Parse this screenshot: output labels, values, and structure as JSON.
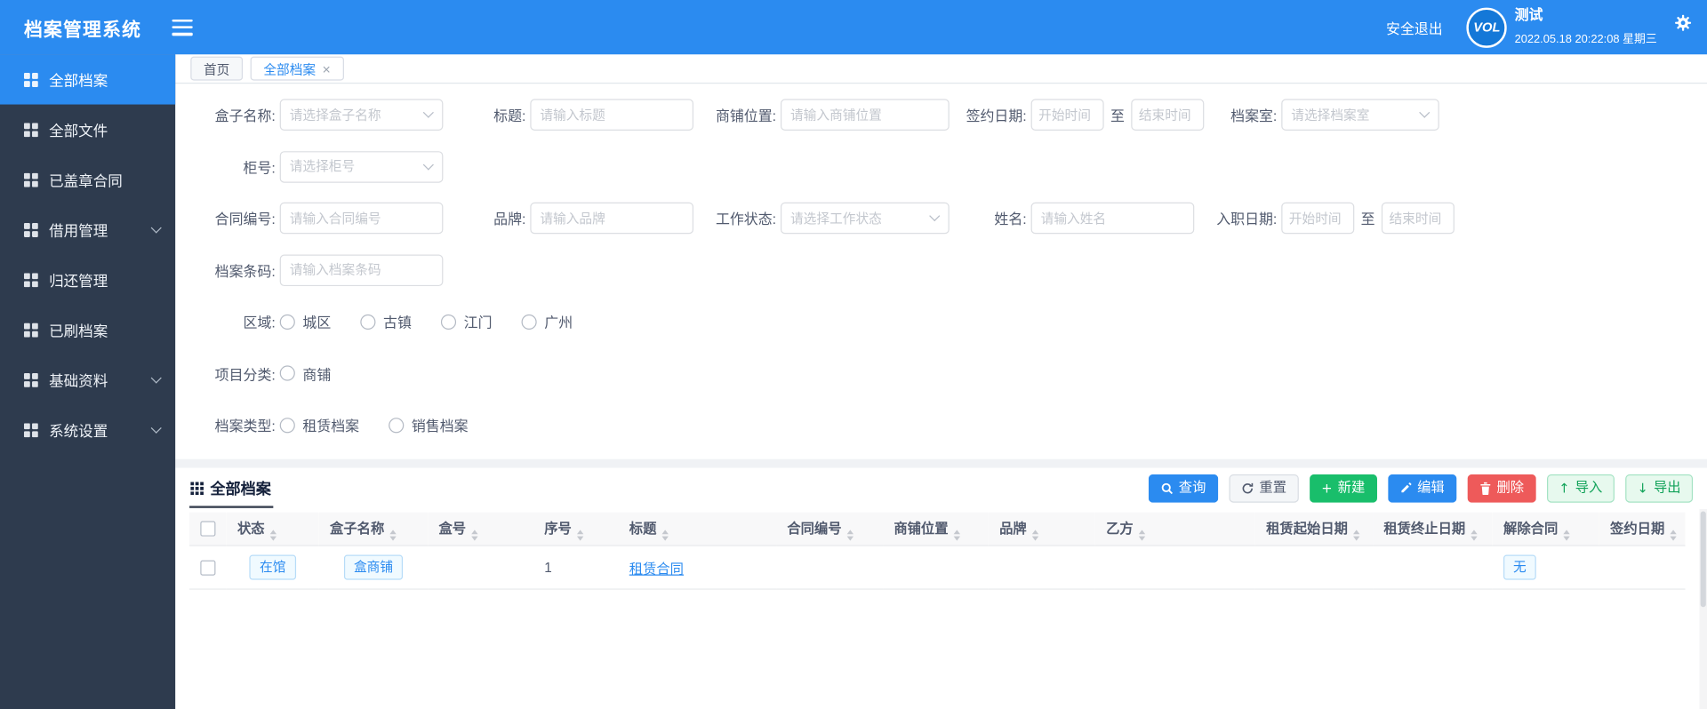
{
  "colors": {
    "brand_blue": "#2b8bf0",
    "sidebar_dark": "#2e3b4e",
    "success_green": "#19be6b",
    "danger_red": "#ee5a5a"
  },
  "header": {
    "app_title": "档案管理系统",
    "logout": "安全退出",
    "logo_text": "VOL",
    "username": "测试",
    "datetime": "2022.05.18 20:22:08 星期三"
  },
  "sidebar": {
    "items": [
      {
        "label": "全部档案"
      },
      {
        "label": "全部文件"
      },
      {
        "label": "已盖章合同"
      },
      {
        "label": "借用管理"
      },
      {
        "label": "归还管理"
      },
      {
        "label": "已刷档案"
      },
      {
        "label": "基础资料"
      },
      {
        "label": "系统设置"
      }
    ]
  },
  "tabs": {
    "home": "首页",
    "current": "全部档案",
    "close": "×"
  },
  "filters": {
    "box_name_label": "盒子名称:",
    "box_name_placeholder": "请选择盒子名称",
    "title_label": "标题:",
    "title_placeholder": "请输入标题",
    "shop_location_label": "商铺位置:",
    "shop_location_placeholder": "请输入商铺位置",
    "sign_date_label": "签约日期:",
    "date_start_placeholder": "开始时间",
    "date_to": "至",
    "date_end_placeholder": "结束时间",
    "archive_room_label": "档案室:",
    "archive_room_placeholder": "请选择档案室",
    "cabinet_label": "柜号:",
    "cabinet_placeholder": "请选择柜号",
    "contract_no_label": "合同编号:",
    "contract_no_placeholder": "请输入合同编号",
    "brand_label": "品牌:",
    "brand_placeholder": "请输入品牌",
    "work_status_label": "工作状态:",
    "work_status_placeholder": "请选择工作状态",
    "name_label": "姓名:",
    "name_placeholder": "请输入姓名",
    "entry_date_label": "入职日期:",
    "barcode_label": "档案条码:",
    "barcode_placeholder": "请输入档案条码",
    "region_label": "区域:",
    "region_options": [
      "城区",
      "古镇",
      "江门",
      "广州"
    ],
    "project_category_label": "项目分类:",
    "project_category_options": [
      "商铺"
    ],
    "archive_type_label": "档案类型:",
    "archive_type_options": [
      "租赁档案",
      "销售档案"
    ]
  },
  "toolbar": {
    "search": "查询",
    "reset": "重置",
    "create": "新建",
    "edit": "编辑",
    "delete": "删除",
    "import": "导入",
    "export": "导出"
  },
  "table": {
    "title": "全部档案",
    "columns": [
      "状态",
      "盒子名称",
      "盒号",
      "序号",
      "标题",
      "合同编号",
      "商铺位置",
      "品牌",
      "乙方",
      "租赁起始日期",
      "租赁终止日期",
      "解除合同",
      "签约日期"
    ],
    "row": {
      "status": "在馆",
      "box_name": "盒商铺",
      "box_no": "",
      "seq": "1",
      "title": "租赁合同",
      "contract_no": "",
      "shop_location": "",
      "brand": "",
      "party_b": "",
      "lease_start": "",
      "lease_end": "",
      "terminate": "无",
      "sign_date": ""
    }
  }
}
